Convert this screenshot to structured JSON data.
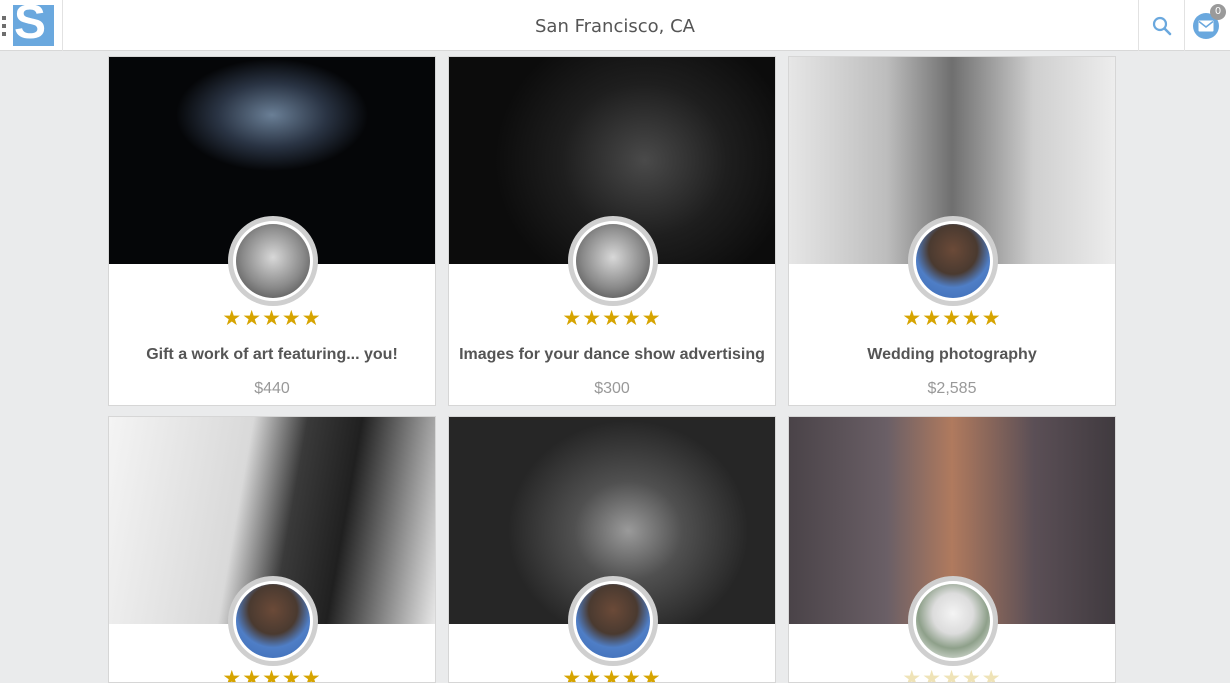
{
  "header": {
    "location": "San Francisco, CA",
    "logo_letter": "S",
    "mail_count": "0",
    "icons": [
      "menu-dots-icon",
      "search-icon",
      "mail-icon"
    ],
    "accent_color": "#6aa8de"
  },
  "cards": [
    {
      "title": "Gift a work of art featuring... you!",
      "price": "$440",
      "stars": "★★★★★",
      "rating": 5
    },
    {
      "title": "Images for your dance show advertising",
      "price": "$300",
      "stars": "★★★★★",
      "rating": 5
    },
    {
      "title": "Wedding photography",
      "price": "$2,585",
      "stars": "★★★★★",
      "rating": 5
    },
    {
      "title": "",
      "price": "",
      "stars": "★★★★★",
      "rating": 5
    },
    {
      "title": "",
      "price": "",
      "stars": "★★★★★",
      "rating": 5
    },
    {
      "title": "",
      "price": "",
      "stars": "★★★★★",
      "rating": 0
    }
  ],
  "colors": {
    "star": "#d6a400",
    "star_empty": "#efe3b7",
    "background": "#eaebec"
  }
}
